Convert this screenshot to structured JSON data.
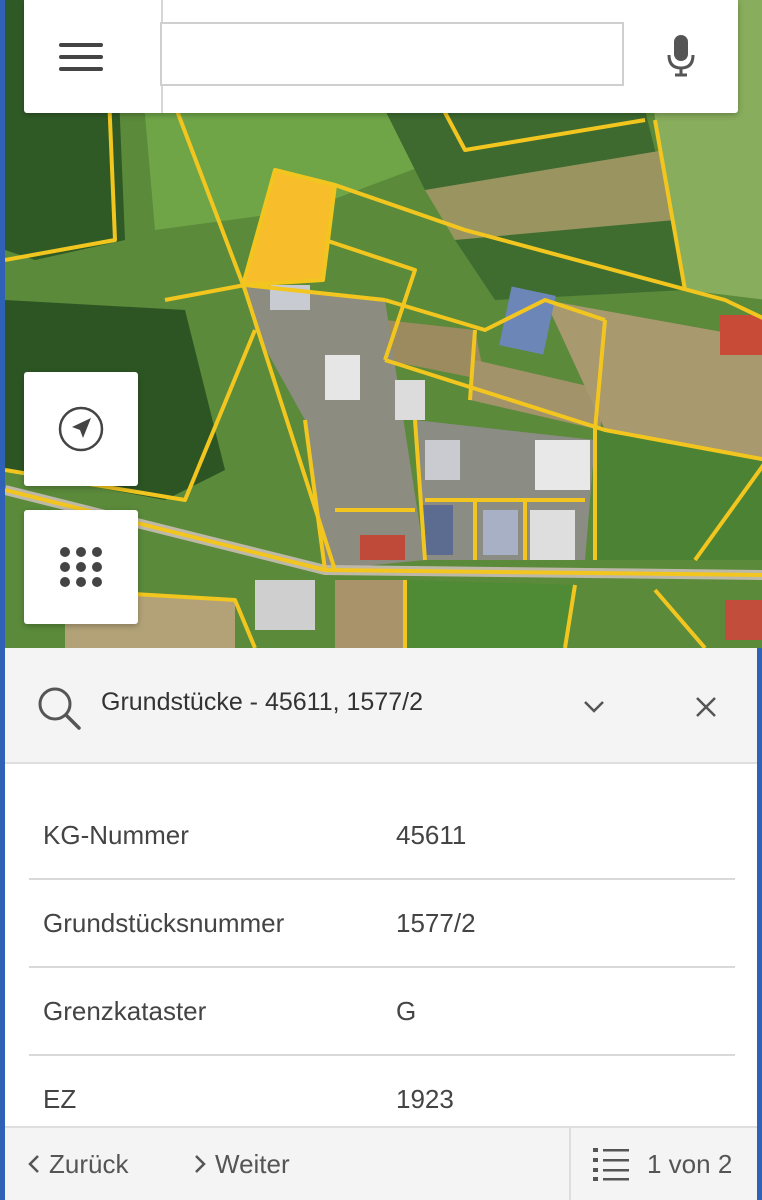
{
  "search": {
    "value": "",
    "placeholder": ""
  },
  "result_panel": {
    "title": "Grundstücke - 45611, 1577/2",
    "attributes": [
      {
        "key": "KG-Nummer",
        "value": "45611"
      },
      {
        "key": "Grundstücksnummer",
        "value": "1577/2"
      },
      {
        "key": "Grenzkataster",
        "value": "G"
      },
      {
        "key": "EZ",
        "value": "1923"
      }
    ]
  },
  "footer": {
    "back_label": "Zurück",
    "next_label": "Weiter",
    "page_indicator": "1 von 2"
  },
  "icons": {
    "menu": "hamburger-icon",
    "microphone": "microphone-icon",
    "locate": "navigation-arrow-icon",
    "apps": "grid-dots-icon",
    "search": "magnifier-icon",
    "expand": "chevron-down-icon",
    "close": "close-icon",
    "back": "chevron-left-icon",
    "next": "chevron-right-icon",
    "list": "list-icon"
  },
  "colors": {
    "parcel_outline": "#f2c61f",
    "selected_parcel": "#f7bd2a",
    "panel_border": "#2f62b6",
    "panel_header": "#f4f4f4"
  }
}
